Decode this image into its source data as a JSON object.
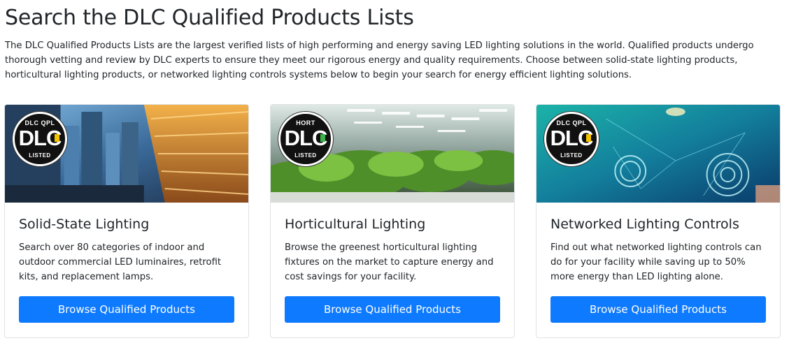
{
  "page": {
    "title": "Search the DLC Qualified Products Lists",
    "intro": "The DLC Qualified Products Lists are the largest verified lists of high performing and energy saving LED lighting solutions in the world. Qualified products undergo thorough vetting and review by DLC experts to ensure they meet our rigorous energy and quality requirements. Choose between solid-state lighting products, horticultural lighting products, or networked lighting controls systems below to begin your search for energy efficient lighting solutions."
  },
  "cards": [
    {
      "title": "Solid-State Lighting",
      "text": "Search over 80 categories of indoor and outdoor commercial LED luminaires, retrofit kits, and replacement lamps.",
      "button": "Browse Qualified Products",
      "badge": {
        "top": "DLC QPL",
        "main": "DLC",
        "bottom": "LISTED",
        "accent": "#f5c400"
      }
    },
    {
      "title": "Horticultural Lighting",
      "text": "Browse the greenest horticultural lighting fixtures on the market to capture energy and cost savings for your facility.",
      "button": "Browse Qualified Products",
      "badge": {
        "top": "HORT",
        "main": "DLC",
        "bottom": "LISTED",
        "accent": "#3cb34a"
      }
    },
    {
      "title": "Networked Lighting Controls",
      "text": "Find out what networked lighting controls can do for your facility while saving up to 50% more energy than LED lighting alone.",
      "button": "Browse Qualified Products",
      "badge": {
        "top": "DLC QPL",
        "main": "DLC",
        "bottom": "LISTED",
        "accent": "#f5c400"
      }
    }
  ],
  "colors": {
    "primary_button": "#0d7aff",
    "text": "#212529",
    "card_border": "#dfe2e5"
  }
}
